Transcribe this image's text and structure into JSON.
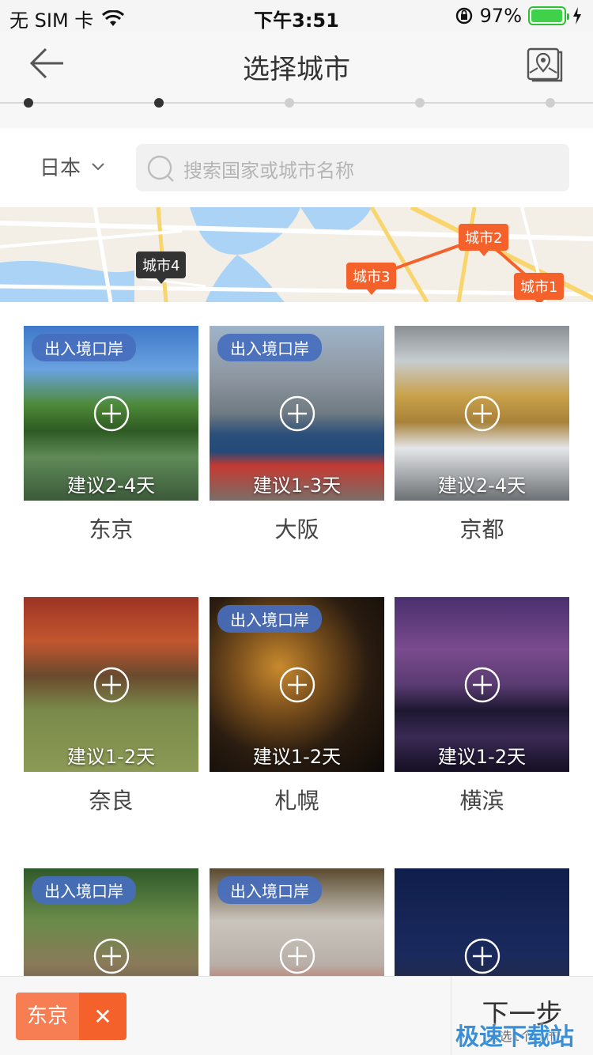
{
  "status_bar": {
    "carrier": "无 SIM 卡",
    "time": "下午3:51",
    "battery": "97%"
  },
  "header": {
    "title": "选择城市"
  },
  "steps": {
    "count": 5,
    "active": 2
  },
  "filter": {
    "country": "日本",
    "search_placeholder": "搜索国家或城市名称"
  },
  "map": {
    "pins": [
      "城市4",
      "城市3",
      "城市2",
      "城市1"
    ]
  },
  "cities": [
    {
      "name": "东京",
      "days": "建议2-4天",
      "badge": "出入境口岸"
    },
    {
      "name": "大阪",
      "days": "建议1-3天",
      "badge": "出入境口岸"
    },
    {
      "name": "京都",
      "days": "建议2-4天",
      "badge": ""
    },
    {
      "name": "奈良",
      "days": "建议1-2天",
      "badge": ""
    },
    {
      "name": "札幌",
      "days": "建议1-2天",
      "badge": "出入境口岸"
    },
    {
      "name": "横滨",
      "days": "建议1-2天",
      "badge": ""
    },
    {
      "name": "",
      "days": "",
      "badge": "出入境口岸"
    },
    {
      "name": "",
      "days": "",
      "badge": "出入境口岸"
    },
    {
      "name": "",
      "days": "",
      "badge": ""
    }
  ],
  "selection": {
    "chip_label": "东京",
    "chip_close": "✕"
  },
  "footer": {
    "next_label": "下一步",
    "next_sub": "已选1个城市"
  },
  "watermark": "极速下载站"
}
